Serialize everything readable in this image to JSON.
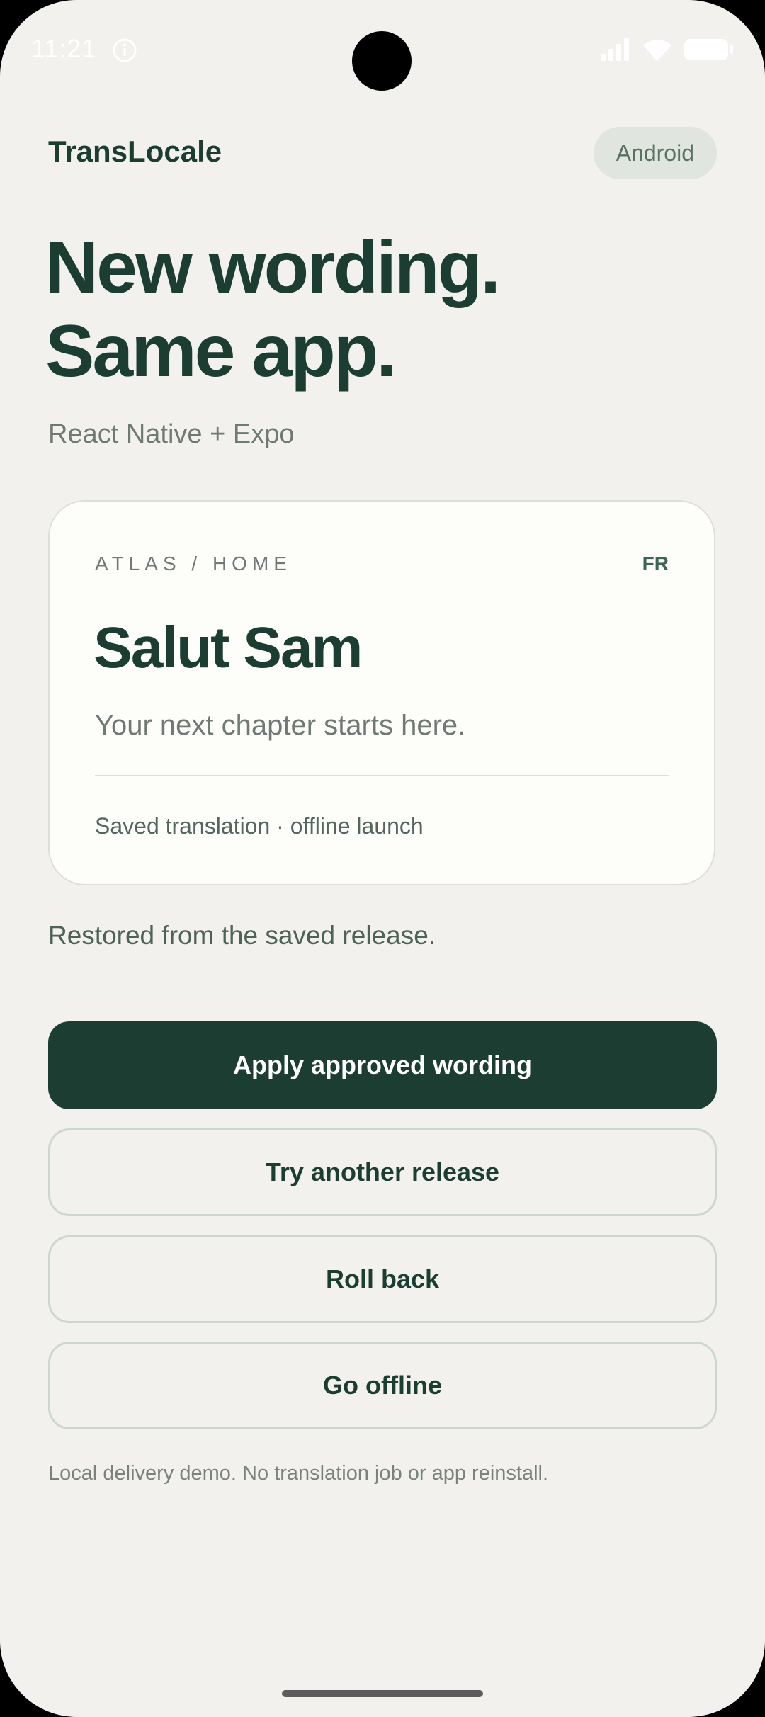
{
  "status_bar": {
    "time": "11:21",
    "icons": [
      "info-icon",
      "signal-icon",
      "wifi-icon",
      "battery-icon"
    ]
  },
  "header": {
    "brand": "TransLocale",
    "platform": "Android"
  },
  "hero": {
    "line1": "New wording.",
    "line2": "Same app.",
    "subtitle": "React Native + Expo"
  },
  "card": {
    "breadcrumb": "ATLAS / HOME",
    "language": "FR",
    "greeting": "Salut Sam",
    "tagline": "Your next chapter starts here.",
    "note": "Saved translation · offline launch"
  },
  "status_message": "Restored from the saved release.",
  "actions": {
    "apply": "Apply approved wording",
    "try_another": "Try another release",
    "roll_back": "Roll back",
    "go_offline": "Go offline"
  },
  "footnote": "Local delivery demo. No translation job or app reinstall.",
  "colors": {
    "background": "#f2f1ee",
    "accent": "#1c3d31",
    "card": "#fdfdf9",
    "muted": "#6e7a74"
  }
}
